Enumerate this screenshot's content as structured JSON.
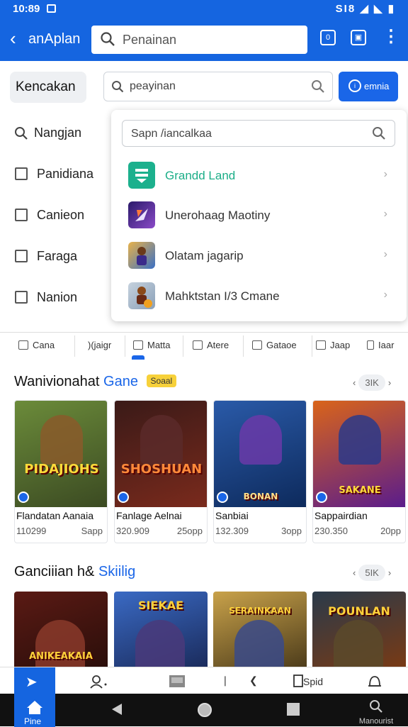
{
  "status": {
    "time": "10:89",
    "right": "ЅӀ8 ◢ ◣ ▮"
  },
  "appbar": {
    "back_icon": "chevron-left-icon",
    "title": "anAplan",
    "search_placeholder": "Penainan"
  },
  "filter": {
    "chip": "Kencakan",
    "search_value": "peayinan",
    "button": "emnia",
    "side_items": [
      "Nangjan",
      "Panidiana",
      "Canieon",
      "Faraga",
      "Nanion"
    ]
  },
  "dropdown": {
    "search_placeholder": "Sapn /iancalkaa",
    "items": [
      {
        "label": "Grandd Land",
        "color": "#1cb08d",
        "icon": "green-app-icon"
      },
      {
        "label": "Unerohaag Maotiny",
        "color": "#5b3fb8",
        "icon": "purple-game-icon"
      },
      {
        "label": "Olatam jagarip",
        "color": "#3a6fc4",
        "icon": "hero-game-icon"
      },
      {
        "label": "Mahktstan I/3 Cmane",
        "color": "#8aa0b8",
        "icon": "warrior-game-icon"
      }
    ]
  },
  "tabs": [
    {
      "label": "Cana"
    },
    {
      "label": ")(jaigr"
    },
    {
      "label": "Matta"
    },
    {
      "label": "Atere"
    },
    {
      "label": "Gataoe"
    },
    {
      "label": "Jaap"
    },
    {
      "label": "Iaar"
    }
  ],
  "section1": {
    "title_a": "Wanivionahat",
    "title_b": "Gane",
    "badge": "Soaal",
    "nav": "3IK",
    "cards": [
      {
        "logo": "PIDAJIOHS",
        "name": "Flandatan Aanaia",
        "count": "110299",
        "size": "Sapp",
        "bg1": "#6b8b3a",
        "bg2": "#3b4a22"
      },
      {
        "logo": "SHOSHUAN",
        "name": "Fanlage Aelnai",
        "count": "320.909",
        "size": "25opp",
        "bg1": "#3a1a18",
        "bg2": "#7a2a1c"
      },
      {
        "logo": "BONAN",
        "name": "Sanbiai",
        "count": "132.309",
        "size": "3opp",
        "bg1": "#2a5aa8",
        "bg2": "#0d2a5c"
      },
      {
        "logo": "SAKANE",
        "name": "Sappairdian",
        "count": "230.350",
        "size": "20pp",
        "bg1": "#d9641a",
        "bg2": "#5a1c8c"
      }
    ]
  },
  "section2": {
    "title_a": "Ganciiian h&",
    "title_b": "Skiilig",
    "nav": "5IK",
    "cards": [
      {
        "logo": "ANIKEAKAIA",
        "bg1": "#5a1a14",
        "bg2": "#2a0e0a"
      },
      {
        "logo": "SIEKAE",
        "bg1": "#3a6ac4",
        "bg2": "#1a2a5a"
      },
      {
        "logo": "SERAINKAAN",
        "bg1": "#c9a24a",
        "bg2": "#4a3a1a"
      },
      {
        "logo": "POUNLAN",
        "bg1": "#2a3a4a",
        "bg2": "#7a3a14"
      }
    ]
  },
  "bottomnav": {
    "home_label": "Pine",
    "store_label": "Spid",
    "search_label": "Manourist"
  }
}
